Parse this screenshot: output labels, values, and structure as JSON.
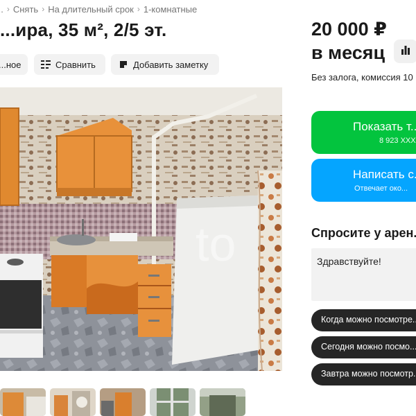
{
  "breadcrumb": {
    "items": [
      "...",
      "Снять",
      "На длительный срок",
      "1-комнатные"
    ]
  },
  "title": "...ира, 35 м², 2/5 эт.",
  "actions": {
    "favorite_label": "...ное",
    "compare_label": "Сравнить",
    "note_label": "Добавить заметку"
  },
  "listing": {
    "price": "20 000 ₽",
    "period": "в месяц",
    "terms": "Без залога, комиссия 10 ..."
  },
  "contact": {
    "show_phone_label": "Показать т...",
    "phone_masked": "8 923 XXX-...",
    "write_label": "Написать с...",
    "reply_note": "Отвечает око..."
  },
  "ask": {
    "title": "Спросите у арен...",
    "message": "Здравствуйте!",
    "suggestions": [
      "Когда можно посмотре...",
      "Сегодня можно посмо...",
      "Завтра можно посмотр..."
    ]
  },
  "gallery": {
    "thumbnail_count": 5
  },
  "colors": {
    "green": "#03c43e",
    "blue": "#05a5ff",
    "chip": "#262626",
    "chip_text": "#ffffff"
  },
  "icons": [
    "chevron-right-icon",
    "heart-icon",
    "compare-icon",
    "note-icon",
    "chart-icon"
  ]
}
